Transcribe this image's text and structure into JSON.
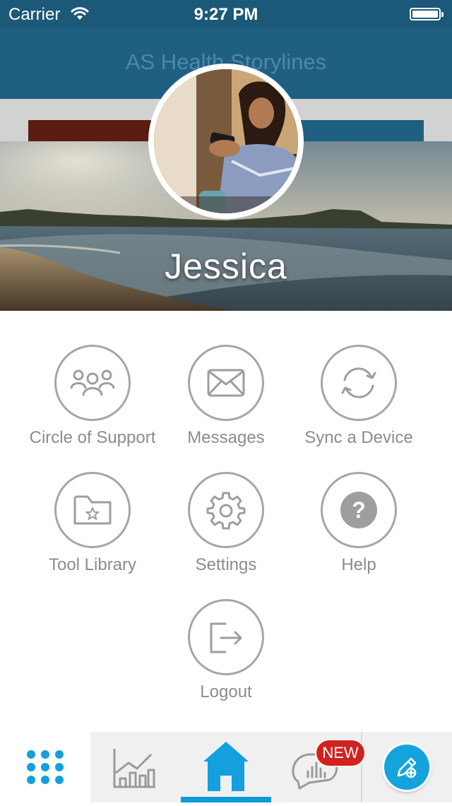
{
  "status_bar": {
    "carrier": "Carrier",
    "time": "9:27 PM"
  },
  "header": {
    "title": "AS Health Storylines"
  },
  "profile": {
    "name": "Jessica"
  },
  "menu": {
    "items": [
      {
        "label": "Circle of Support",
        "icon": "people-group-icon"
      },
      {
        "label": "Messages",
        "icon": "envelope-icon"
      },
      {
        "label": "Sync a Device",
        "icon": "sync-arrows-icon"
      },
      {
        "label": "Tool Library",
        "icon": "folder-star-icon"
      },
      {
        "label": "Settings",
        "icon": "gear-icon"
      },
      {
        "label": "Help",
        "icon": "question-icon"
      },
      {
        "label": "Logout",
        "icon": "logout-icon"
      }
    ]
  },
  "tab_bar": {
    "tabs": [
      {
        "name": "apps",
        "icon": "grid-dots-icon"
      },
      {
        "name": "charts",
        "icon": "bar-chart-icon"
      },
      {
        "name": "home",
        "icon": "home-icon",
        "selected": true
      },
      {
        "name": "updates",
        "icon": "speech-chart-icon",
        "badge": "NEW"
      },
      {
        "name": "add-entry",
        "icon": "pencil-plus-icon"
      }
    ],
    "accent_color": "#0f9ad8",
    "badge_color": "#d0231f"
  }
}
